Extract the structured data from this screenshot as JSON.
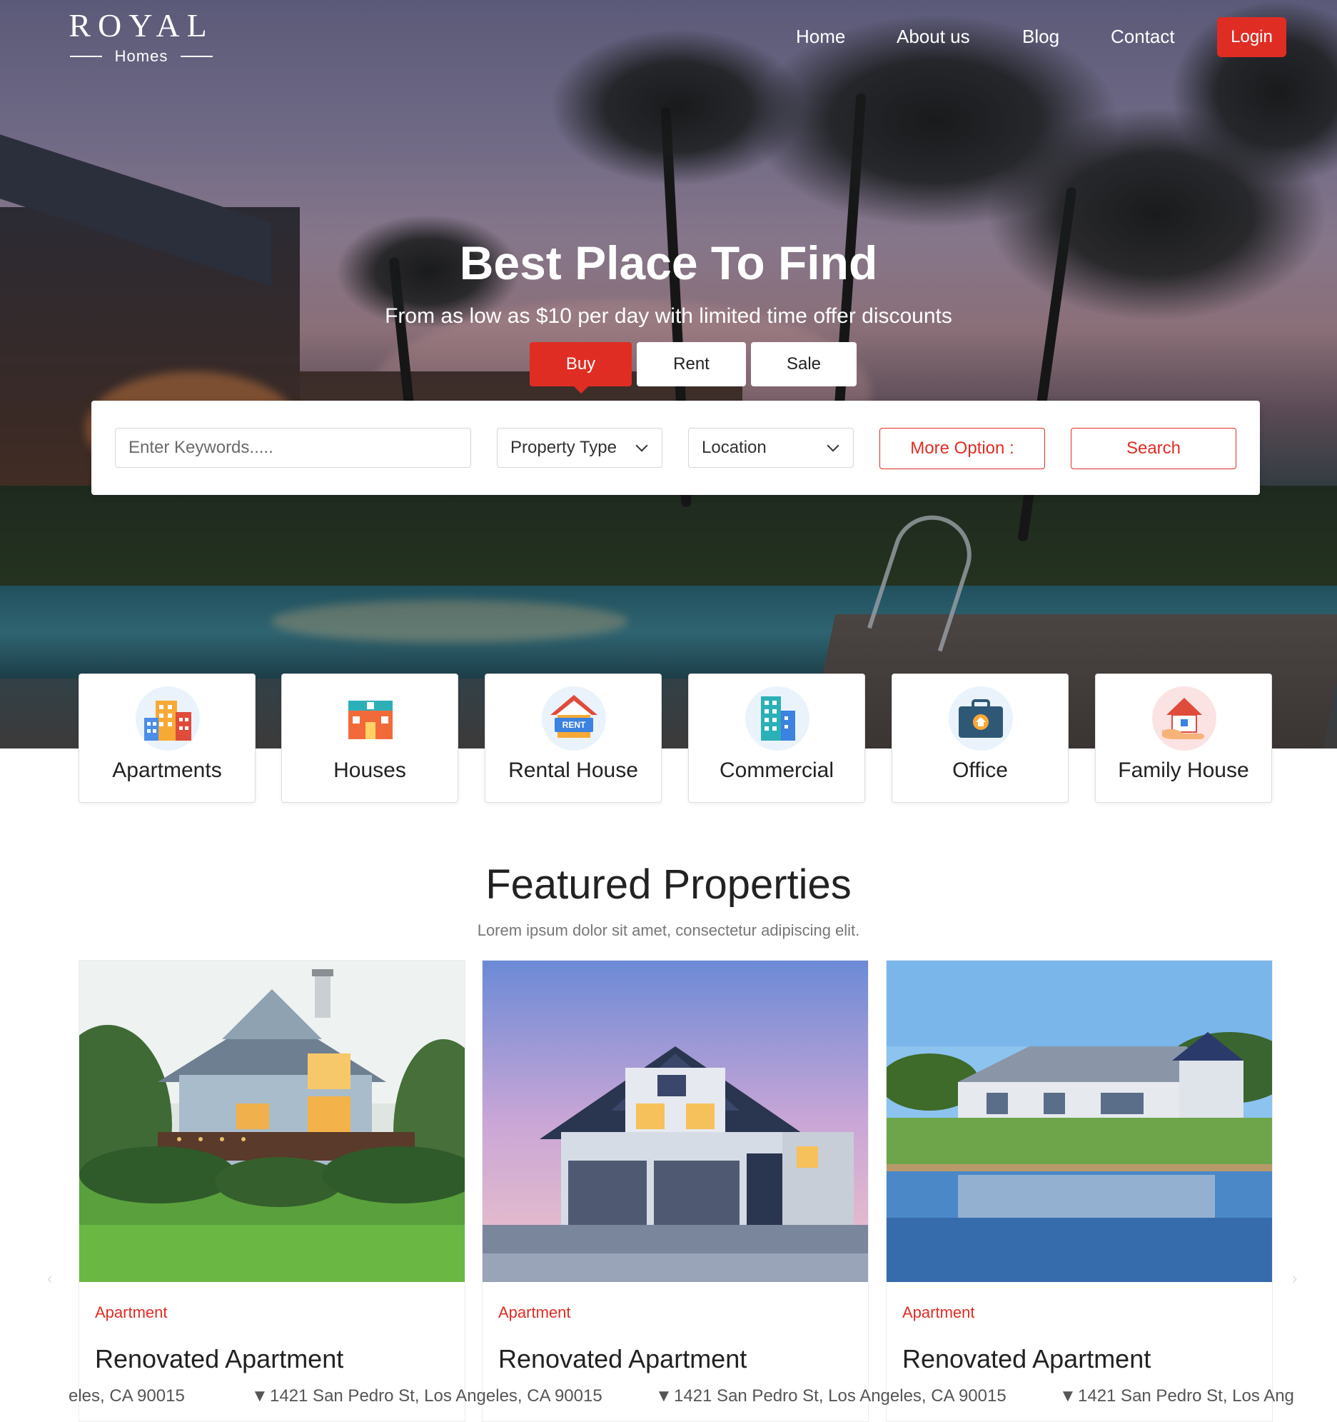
{
  "logo": {
    "brand": "ROYAL",
    "sub": "Homes"
  },
  "nav": {
    "items": [
      "Home",
      "About us",
      "Blog",
      "Contact"
    ],
    "login": "Login"
  },
  "hero": {
    "title": "Best Place To Find",
    "subtitle": "From as low as $10 per day with limited time offer discounts",
    "tabs": [
      "Buy",
      "Rent",
      "Sale"
    ],
    "active_tab": "Buy"
  },
  "search": {
    "keyword_placeholder": "Enter Keywords.....",
    "property_type": "Property Type",
    "location": "Location",
    "more_option": "More Option :",
    "search_button": "Search"
  },
  "categories": [
    {
      "label": "Apartments",
      "icon": "apartments-icon"
    },
    {
      "label": "Houses",
      "icon": "houses-icon"
    },
    {
      "label": "Rental House",
      "icon": "rental-house-icon",
      "icon_text": "RENT"
    },
    {
      "label": "Commercial",
      "icon": "commercial-icon"
    },
    {
      "label": "Office",
      "icon": "office-icon"
    },
    {
      "label": "Family House",
      "icon": "family-house-icon"
    }
  ],
  "featured": {
    "title": "Featured Properties",
    "subtitle": "Lorem ipsum dolor sit amet, consectetur adipiscing elit.",
    "properties": [
      {
        "type": "Apartment",
        "name": "Renovated Apartment"
      },
      {
        "type": "Apartment",
        "name": "Renovated Apartment"
      },
      {
        "type": "Apartment",
        "name": "Renovated Apartment"
      }
    ],
    "address_fragments": [
      "eles, CA 90015",
      "1421 San Pedro St, Los Angeles, CA 90015",
      "1421 San Pedro St, Los Angeles, CA 90015",
      "1421 San Pedro St, Los Ang"
    ]
  },
  "colors": {
    "accent": "#e02d23"
  }
}
